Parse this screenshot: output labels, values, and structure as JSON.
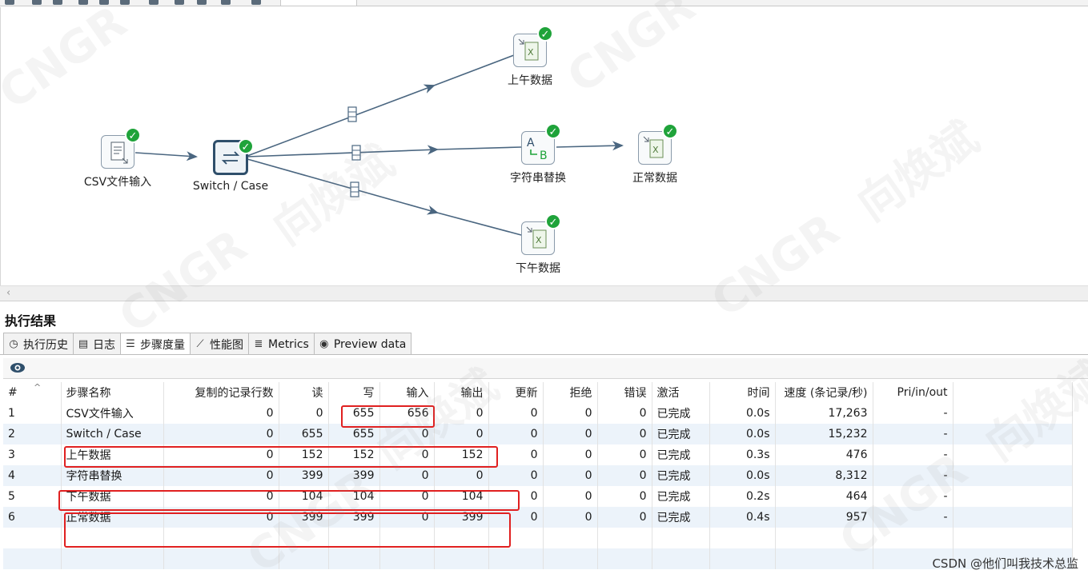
{
  "canvas": {
    "steps": [
      {
        "id": "csv",
        "label": "CSV文件输入",
        "icon": "csv-file-icon"
      },
      {
        "id": "switch",
        "label": "Switch / Case",
        "icon": "switch-case-icon"
      },
      {
        "id": "am",
        "label": "上午数据",
        "icon": "excel-output-icon"
      },
      {
        "id": "replace",
        "label": "字符串替换",
        "icon": "string-replace-icon"
      },
      {
        "id": "normal",
        "label": "正常数据",
        "icon": "excel-output-icon"
      },
      {
        "id": "pm",
        "label": "下午数据",
        "icon": "excel-output-icon"
      }
    ],
    "status_icon": "success-check-icon"
  },
  "results": {
    "title": "执行结果",
    "tabs": [
      {
        "label": "执行历史",
        "icon": "history-icon"
      },
      {
        "label": "日志",
        "icon": "log-icon"
      },
      {
        "label": "步骤度量",
        "icon": "step-metrics-icon",
        "active": true
      },
      {
        "label": "性能图",
        "icon": "performance-chart-icon"
      },
      {
        "label": "Metrics",
        "icon": "metrics-icon"
      },
      {
        "label": "Preview data",
        "icon": "preview-eye-icon"
      }
    ],
    "columns": [
      "#",
      "步骤名称",
      "复制的记录行数",
      "读",
      "写",
      "输入",
      "输出",
      "更新",
      "拒绝",
      "错误",
      "激活",
      "时间",
      "速度 (条记录/秒)",
      "Pri/in/out"
    ],
    "rows": [
      [
        "1",
        "CSV文件输入",
        "0",
        "0",
        "655",
        "656",
        "0",
        "0",
        "0",
        "0",
        "已完成",
        "0.0s",
        "17,263",
        "-"
      ],
      [
        "2",
        "Switch / Case",
        "0",
        "655",
        "655",
        "0",
        "0",
        "0",
        "0",
        "0",
        "已完成",
        "0.0s",
        "15,232",
        "-"
      ],
      [
        "3",
        "上午数据",
        "0",
        "152",
        "152",
        "0",
        "152",
        "0",
        "0",
        "0",
        "已完成",
        "0.3s",
        "476",
        "-"
      ],
      [
        "4",
        "字符串替换",
        "0",
        "399",
        "399",
        "0",
        "0",
        "0",
        "0",
        "0",
        "已完成",
        "0.0s",
        "8,312",
        "-"
      ],
      [
        "5",
        "下午数据",
        "0",
        "104",
        "104",
        "0",
        "104",
        "0",
        "0",
        "0",
        "已完成",
        "0.2s",
        "464",
        "-"
      ],
      [
        "6",
        "正常数据",
        "0",
        "399",
        "399",
        "0",
        "399",
        "0",
        "0",
        "0",
        "已完成",
        "0.4s",
        "957",
        "-"
      ]
    ]
  },
  "watermark": {
    "brand": "CNGR",
    "text": "向焕斌"
  },
  "footer": {
    "credit": "CSDN @他们叫我技术总监"
  }
}
